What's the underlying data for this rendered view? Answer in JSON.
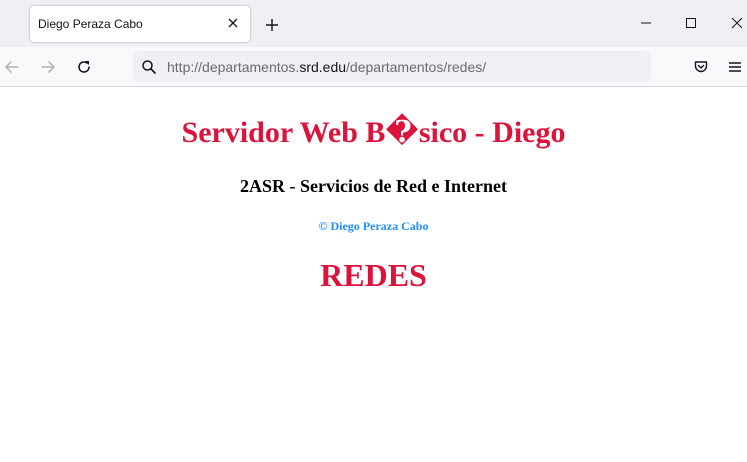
{
  "browser": {
    "tab": {
      "title": "Diego Peraza Cabo"
    },
    "urlbar": {
      "scheme": "http://",
      "subdomain": "departamentos.",
      "host": "srd.edu",
      "path": "/departamentos/redes/"
    },
    "icons": {
      "tab_close": "close-icon",
      "new_tab": "plus-icon",
      "minimize": "minimize-icon",
      "maximize": "maximize-icon",
      "close_window": "close-icon",
      "back": "arrow-left-icon",
      "forward": "arrow-right-icon",
      "reload": "reload-icon",
      "search": "search-icon",
      "pocket": "pocket-icon",
      "menu": "hamburger-menu-icon"
    }
  },
  "page": {
    "title": "Servidor Web B�sico - Diego",
    "subtitle": "2ASR - Servicios de Red e Internet",
    "copyright": "© Diego Peraza Cabo",
    "section": "REDES"
  },
  "colors": {
    "heading": "#dc143c",
    "copyright": "#1e90ff"
  }
}
